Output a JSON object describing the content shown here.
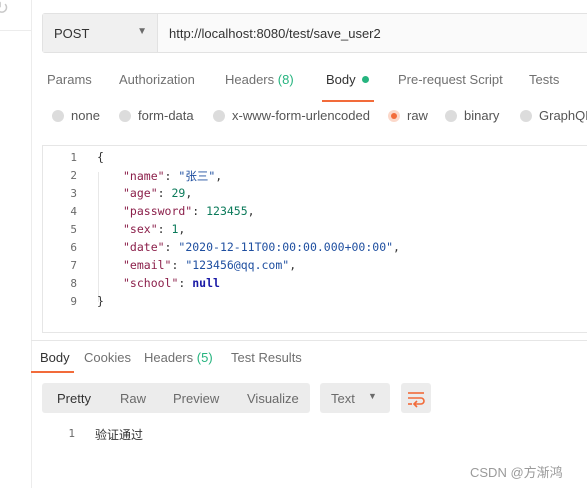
{
  "request": {
    "method": "POST",
    "url": "http://localhost:8080/test/save_user2"
  },
  "request_tabs": [
    {
      "label": "Params"
    },
    {
      "label": "Authorization"
    },
    {
      "label": "Headers",
      "count": "(8)"
    },
    {
      "label": "Body",
      "active": true
    },
    {
      "label": "Pre-request Script"
    },
    {
      "label": "Tests"
    }
  ],
  "body_modes": [
    {
      "label": "none",
      "checked": false
    },
    {
      "label": "form-data",
      "checked": false
    },
    {
      "label": "x-www-form-urlencoded",
      "checked": false
    },
    {
      "label": "raw",
      "checked": true
    },
    {
      "label": "binary",
      "checked": false
    },
    {
      "label": "GraphQL",
      "checked": false
    }
  ],
  "editor": {
    "line_numbers": [
      "1",
      "2",
      "3",
      "4",
      "5",
      "6",
      "7",
      "8",
      "9"
    ],
    "open_brace": "{",
    "close_brace": "}",
    "fields": [
      {
        "key": "\"name\"",
        "value": "\"张三\"",
        "kind": "string"
      },
      {
        "key": "\"age\"",
        "value": "29",
        "kind": "number"
      },
      {
        "key": "\"password\"",
        "value": "123455",
        "kind": "number"
      },
      {
        "key": "\"sex\"",
        "value": "1",
        "kind": "number"
      },
      {
        "key": "\"date\"",
        "value": "\"2020-12-11T00:00:00.000+00:00\"",
        "kind": "string"
      },
      {
        "key": "\"email\"",
        "value": "\"123456@qq.com\"",
        "kind": "string"
      },
      {
        "key": "\"school\"",
        "value": "null",
        "kind": "null"
      }
    ]
  },
  "response_tabs": [
    {
      "label": "Body",
      "active": true
    },
    {
      "label": "Cookies"
    },
    {
      "label": "Headers",
      "count": "(5)"
    },
    {
      "label": "Test Results"
    }
  ],
  "view_modes": [
    "Pretty",
    "Raw",
    "Preview",
    "Visualize"
  ],
  "format": "Text",
  "response": {
    "line_number": "1",
    "text": "验证通过"
  },
  "watermark": "CSDN @方渐鸿",
  "colors": {
    "accent": "#f26b3a",
    "count_green": "#26b47f"
  }
}
